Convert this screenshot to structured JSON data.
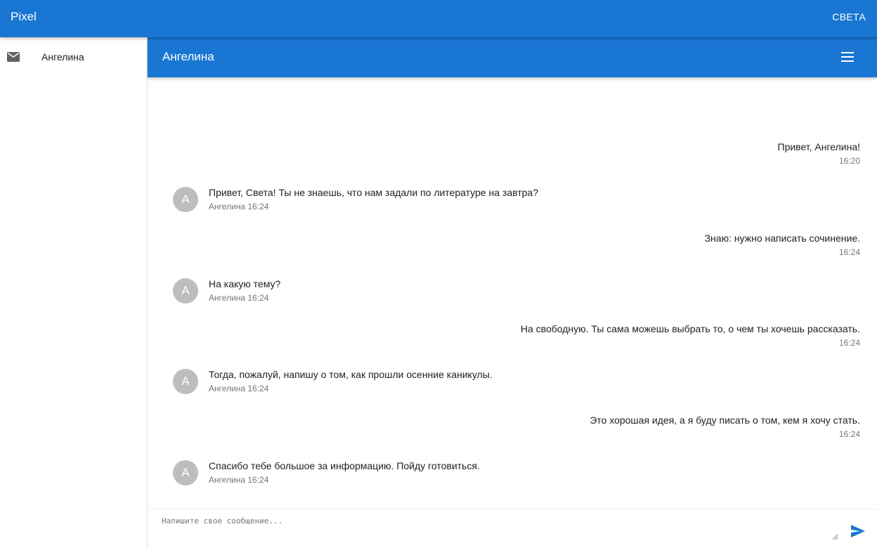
{
  "appbar": {
    "title": "Pixel",
    "user": "СВЕТА"
  },
  "sidebar": {
    "items": [
      {
        "label": "Ангелина",
        "icon": "mail-icon"
      }
    ]
  },
  "chat": {
    "title": "Ангелина",
    "menu_icon": "hamburger-menu-icon"
  },
  "messages": [
    {
      "direction": "out",
      "text": "Привет, Ангелина!",
      "time": "16:20"
    },
    {
      "direction": "in",
      "avatar": "А",
      "text": "Привет, Света! Ты не знаешь, что нам задали по литературе на завтра?",
      "meta": "Ангелина 16:24"
    },
    {
      "direction": "out",
      "text": "Знаю: нужно написать сочинение.",
      "time": "16:24"
    },
    {
      "direction": "in",
      "avatar": "А",
      "text": "На какую тему?",
      "meta": "Ангелина 16:24"
    },
    {
      "direction": "out",
      "text": "На свободную. Ты сама можешь выбрать то, о чем ты хочешь рассказать.",
      "time": "16:24"
    },
    {
      "direction": "in",
      "avatar": "А",
      "text": "Тогда, пожалуй, напишу о том, как прошли осенние каникулы.",
      "meta": "Ангелина 16:24"
    },
    {
      "direction": "out",
      "text": "Это хорошая идея, а я буду писать о том, кем я хочу стать.",
      "time": "16:24"
    },
    {
      "direction": "in",
      "avatar": "А",
      "text": "Спасибо тебе большое за информацию. Пойду готовиться.",
      "meta": "Ангелина 16:24"
    }
  ],
  "composer": {
    "placeholder": "Напишите свое сообщение...",
    "value": "",
    "send_icon": "send-icon"
  },
  "colors": {
    "primary": "#1976d2",
    "avatar_bg": "#bdbdbd",
    "secondary_text": "#757575"
  }
}
